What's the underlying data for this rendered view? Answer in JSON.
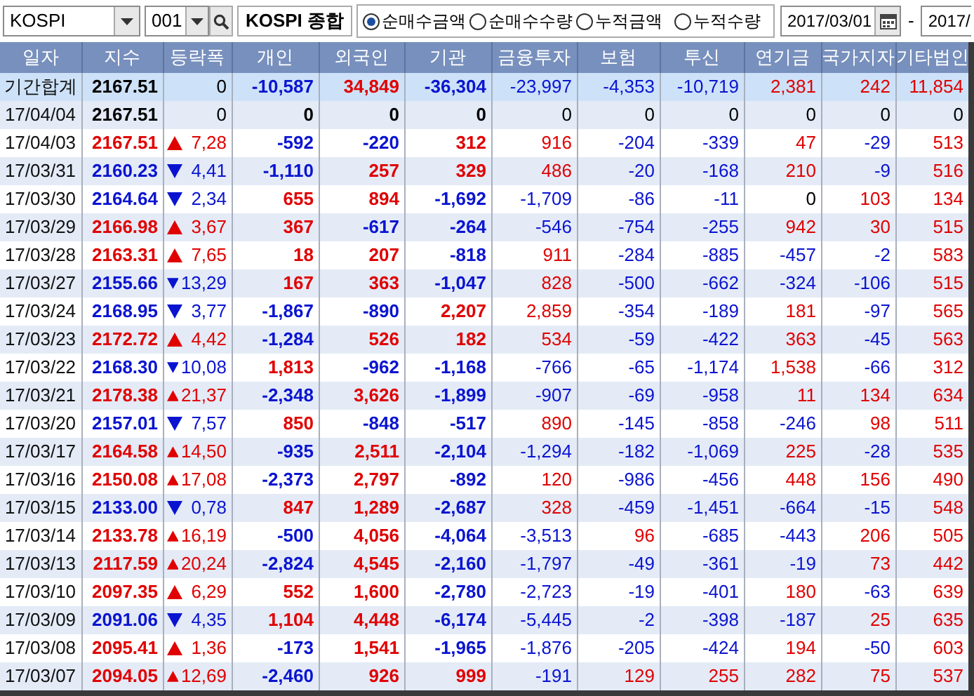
{
  "toolbar": {
    "market": "KOSPI",
    "code": "001",
    "name": "KOSPI 종합",
    "modes": [
      {
        "label": "순매수금액",
        "selected": true
      },
      {
        "label": "순매수수량",
        "selected": false
      },
      {
        "label": "누적금액",
        "selected": false
      },
      {
        "label": "누적수량",
        "selected": false
      }
    ],
    "start_date": "2017/03/01",
    "separator": "-",
    "end_date": "2017/"
  },
  "table": {
    "columns": [
      "일자",
      "지수",
      "등락폭",
      "개인",
      "외국인",
      "기관",
      "금융투자",
      "보험",
      "투신",
      "연기금",
      "국가지자",
      "기타법인"
    ],
    "rows": [
      {
        "kind": "total",
        "cells": [
          "기간합계",
          "2167.51",
          "0",
          "-10,587",
          "34,849",
          "-36,304",
          "-23,997",
          "-4,353",
          "-10,719",
          "2,381",
          "242",
          "11,854"
        ]
      },
      {
        "kind": "flat",
        "cells": [
          "17/04/04",
          "2167.51",
          "0",
          "0",
          "0",
          "0",
          "0",
          "0",
          "0",
          "0",
          "0",
          "0"
        ]
      },
      {
        "kind": "up",
        "cells": [
          "17/04/03",
          "2167.51",
          "7,28",
          "-592",
          "-220",
          "312",
          "916",
          "-204",
          "-339",
          "47",
          "-29",
          "513"
        ]
      },
      {
        "kind": "down",
        "cells": [
          "17/03/31",
          "2160.23",
          "4,41",
          "-1,110",
          "257",
          "329",
          "486",
          "-20",
          "-168",
          "210",
          "-9",
          "516"
        ]
      },
      {
        "kind": "down",
        "cells": [
          "17/03/30",
          "2164.64",
          "2,34",
          "655",
          "894",
          "-1,692",
          "-1,709",
          "-86",
          "-11",
          "0",
          "103",
          "134"
        ]
      },
      {
        "kind": "up",
        "cells": [
          "17/03/29",
          "2166.98",
          "3,67",
          "367",
          "-617",
          "-264",
          "-546",
          "-754",
          "-255",
          "942",
          "30",
          "515"
        ]
      },
      {
        "kind": "up",
        "cells": [
          "17/03/28",
          "2163.31",
          "7,65",
          "18",
          "207",
          "-818",
          "911",
          "-284",
          "-885",
          "-457",
          "-2",
          "583"
        ]
      },
      {
        "kind": "down",
        "cells": [
          "17/03/27",
          "2155.66",
          "13,29",
          "167",
          "363",
          "-1,047",
          "828",
          "-500",
          "-662",
          "-324",
          "-106",
          "515"
        ]
      },
      {
        "kind": "down",
        "cells": [
          "17/03/24",
          "2168.95",
          "3,77",
          "-1,867",
          "-890",
          "2,207",
          "2,859",
          "-354",
          "-189",
          "181",
          "-97",
          "565"
        ]
      },
      {
        "kind": "up",
        "cells": [
          "17/03/23",
          "2172.72",
          "4,42",
          "-1,284",
          "526",
          "182",
          "534",
          "-59",
          "-422",
          "363",
          "-45",
          "563"
        ]
      },
      {
        "kind": "down",
        "cells": [
          "17/03/22",
          "2168.30",
          "10,08",
          "1,813",
          "-962",
          "-1,168",
          "-766",
          "-65",
          "-1,174",
          "1,538",
          "-66",
          "312"
        ]
      },
      {
        "kind": "up",
        "cells": [
          "17/03/21",
          "2178.38",
          "21,37",
          "-2,348",
          "3,626",
          "-1,899",
          "-907",
          "-69",
          "-958",
          "11",
          "134",
          "634"
        ]
      },
      {
        "kind": "down",
        "cells": [
          "17/03/20",
          "2157.01",
          "7,57",
          "850",
          "-848",
          "-517",
          "890",
          "-145",
          "-858",
          "-246",
          "98",
          "511"
        ]
      },
      {
        "kind": "up",
        "cells": [
          "17/03/17",
          "2164.58",
          "14,50",
          "-935",
          "2,511",
          "-2,104",
          "-1,294",
          "-182",
          "-1,069",
          "225",
          "-28",
          "535"
        ]
      },
      {
        "kind": "up",
        "cells": [
          "17/03/16",
          "2150.08",
          "17,08",
          "-2,373",
          "2,797",
          "-892",
          "120",
          "-986",
          "-456",
          "448",
          "156",
          "490"
        ]
      },
      {
        "kind": "down",
        "cells": [
          "17/03/15",
          "2133.00",
          "0,78",
          "847",
          "1,289",
          "-2,687",
          "328",
          "-459",
          "-1,451",
          "-664",
          "-15",
          "548"
        ]
      },
      {
        "kind": "up",
        "cells": [
          "17/03/14",
          "2133.78",
          "16,19",
          "-500",
          "4,056",
          "-4,064",
          "-3,513",
          "96",
          "-685",
          "-443",
          "206",
          "505"
        ]
      },
      {
        "kind": "up",
        "cells": [
          "17/03/13",
          "2117.59",
          "20,24",
          "-2,824",
          "4,545",
          "-2,160",
          "-1,797",
          "-49",
          "-361",
          "-19",
          "73",
          "442"
        ]
      },
      {
        "kind": "up",
        "cells": [
          "17/03/10",
          "2097.35",
          "6,29",
          "552",
          "1,600",
          "-2,780",
          "-2,723",
          "-19",
          "-401",
          "180",
          "-63",
          "639"
        ]
      },
      {
        "kind": "down",
        "cells": [
          "17/03/09",
          "2091.06",
          "4,35",
          "1,104",
          "4,448",
          "-6,174",
          "-5,445",
          "-2",
          "-398",
          "-187",
          "25",
          "635"
        ]
      },
      {
        "kind": "up",
        "cells": [
          "17/03/08",
          "2095.41",
          "1,36",
          "-173",
          "1,541",
          "-1,965",
          "-1,876",
          "-205",
          "-424",
          "194",
          "-50",
          "603"
        ]
      },
      {
        "kind": "up",
        "cells": [
          "17/03/07",
          "2094.05",
          "12,69",
          "-2,460",
          "926",
          "999",
          "-191",
          "129",
          "255",
          "282",
          "75",
          "537"
        ]
      }
    ]
  }
}
